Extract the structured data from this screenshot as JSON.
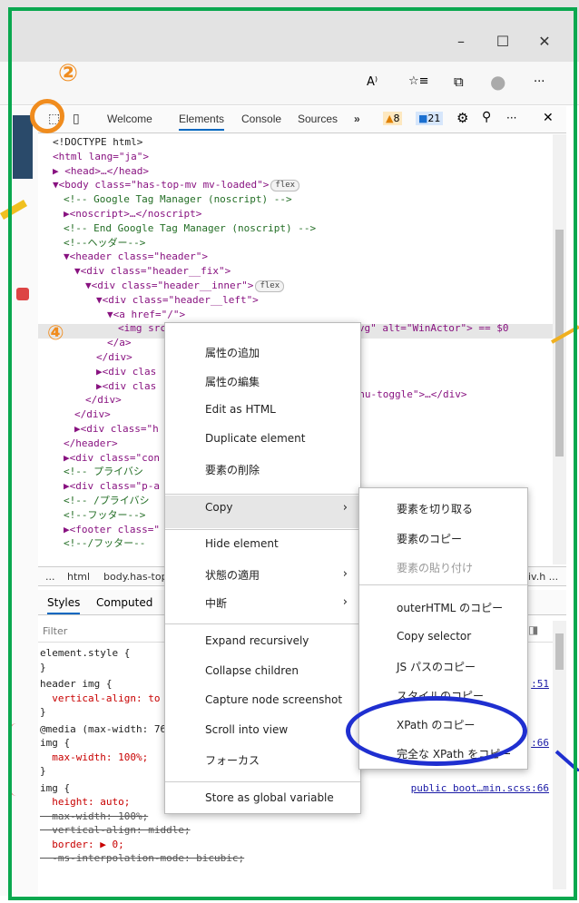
{
  "window": {
    "minimize": "–",
    "maximize": "☐",
    "close": "✕"
  },
  "browser_toolbar": {
    "reading_icon": "A⁾",
    "favorites_icon": "☆≡",
    "collections_icon": "⧉",
    "profile": "●",
    "more": "···"
  },
  "steps": {
    "step2": "②",
    "step4": "④"
  },
  "devtools": {
    "tabs": [
      "Welcome",
      "Elements",
      "Console",
      "Sources",
      "»"
    ],
    "warnings": "8",
    "messages": "21",
    "more": "···",
    "close": "✕"
  },
  "dom_lines": [
    {
      "t": "<!DOCTYPE html>",
      "c": "txt",
      "i": 1
    },
    {
      "t": "<html lang=\"ja\">",
      "c": "tag",
      "i": 1
    },
    {
      "t": "▶ <head>…</head>",
      "c": "tag",
      "i": 1
    },
    {
      "t": "▼<body class=\"has-top-mv mv-loaded\">",
      "c": "tag",
      "i": 1,
      "pill": "flex"
    },
    {
      "t": "<!-- Google Tag Manager (noscript) -->",
      "c": "cmt",
      "i": 2
    },
    {
      "t": "▶<noscript>…</noscript>",
      "c": "tag",
      "i": 2
    },
    {
      "t": "<!-- End Google Tag Manager (noscript) -->",
      "c": "cmt",
      "i": 2
    },
    {
      "t": "<!--ヘッダー-->",
      "c": "cmt",
      "i": 2
    },
    {
      "t": "▼<header class=\"header\">",
      "c": "tag",
      "i": 2
    },
    {
      "t": "▼<div class=\"header__fix\">",
      "c": "tag",
      "i": 3
    },
    {
      "t": "▼<div class=\"header__inner\">",
      "c": "tag",
      "i": 4,
      "pill": "flex"
    },
    {
      "t": "▼<div class=\"header__left\">",
      "c": "tag",
      "i": 5
    },
    {
      "t": "▼<a href=\"/\">",
      "c": "tag",
      "i": 6
    },
    {
      "t": "<img src=\"/assets/images/common/logo-w.svg\" alt=\"WinActor\"> == $0",
      "c": "tag",
      "i": 7
    },
    {
      "t": "</a>",
      "c": "tag",
      "i": 6
    },
    {
      "t": "</div>",
      "c": "tag",
      "i": 5
    },
    {
      "t": "▶<div clas",
      "c": "tag",
      "i": 5
    },
    {
      "t": "▶<div clas",
      "c": "tag",
      "i": 5
    },
    {
      "t": "</div>",
      "c": "tag",
      "i": 4
    },
    {
      "t": "</div>",
      "c": "tag",
      "i": 3
    },
    {
      "t": "▶<div class=\"h",
      "c": "tag",
      "i": 3
    },
    {
      "t": "</header>",
      "c": "tag",
      "i": 2
    },
    {
      "t": "▶<div class=\"con",
      "c": "tag",
      "i": 2
    },
    {
      "t": "<!-- プライバシ",
      "c": "cmt",
      "i": 2
    },
    {
      "t": "▶<div class=\"p-a",
      "c": "tag",
      "i": 2
    },
    {
      "t": "<!-- /プライバシ",
      "c": "cmt",
      "i": 2
    },
    {
      "t": "<!--フッター-->",
      "c": "cmt",
      "i": 2
    },
    {
      "t": "▶<footer class=\"",
      "c": "tag",
      "i": 2
    },
    {
      "t": "<!--/フッター--",
      "c": "cmt",
      "i": 2
    }
  ],
  "dom_extra": {
    "menu_toggle": "menu-toggle\">…</div>"
  },
  "breadcrumbs": {
    "dots": "...",
    "items": [
      "html",
      "body.has-top"
    ],
    "tail": "iv.h ..."
  },
  "styles_tabs": [
    "Styles",
    "Computed"
  ],
  "filter_placeholder": "Filter",
  "styles_lines": [
    {
      "t": "element.style {",
      "k": "sel"
    },
    {
      "t": "}",
      "k": "sel"
    },
    {
      "t": "header img {",
      "k": "sel",
      "link": ":51"
    },
    {
      "t": "  vertical-align: to",
      "k": "prop"
    },
    {
      "t": "}",
      "k": "sel"
    },
    {
      "t": "@media (max-width: 76",
      "k": "sel"
    },
    {
      "t": "img {",
      "k": "sel",
      "link": ":66"
    },
    {
      "t": "  max-width: 100%;",
      "k": "prop"
    },
    {
      "t": "}",
      "k": "sel"
    },
    {
      "t": "img {",
      "k": "sel",
      "link": "public boot…min.scss:66"
    },
    {
      "t": "  height: auto;",
      "k": "prop"
    },
    {
      "t": "  max-width: 100%;",
      "k": "strike"
    },
    {
      "t": "  vertical-align: middle;",
      "k": "strike"
    },
    {
      "t": "  border: ▶ 0;",
      "k": "prop"
    },
    {
      "t": "  -ms-interpolation-mode: bicubic;",
      "k": "strike"
    }
  ],
  "context_menu": {
    "items": [
      "属性の追加",
      "属性の編集",
      "Edit as HTML",
      "Duplicate element",
      "要素の削除",
      "Copy",
      "Hide element",
      "状態の適用",
      "中断",
      "Expand recursively",
      "Collapse children",
      "Capture node screenshot",
      "Scroll into view",
      "フォーカス",
      "Store as global variable"
    ],
    "submenu_arrow": "›"
  },
  "copy_submenu": {
    "items": [
      "要素を切り取る",
      "要素のコピー",
      "要素の貼り付け",
      "outerHTML のコピー",
      "Copy selector",
      "JS パスのコピー",
      "スタイルのコピー",
      "XPath のコピー",
      "完全な XPath をコピー"
    ]
  },
  "colors": {
    "frame": "#0aa84f",
    "highlight_circle": "#1f2fd0",
    "step_badge": "#f08c1e",
    "arrow": "#f0b020"
  }
}
